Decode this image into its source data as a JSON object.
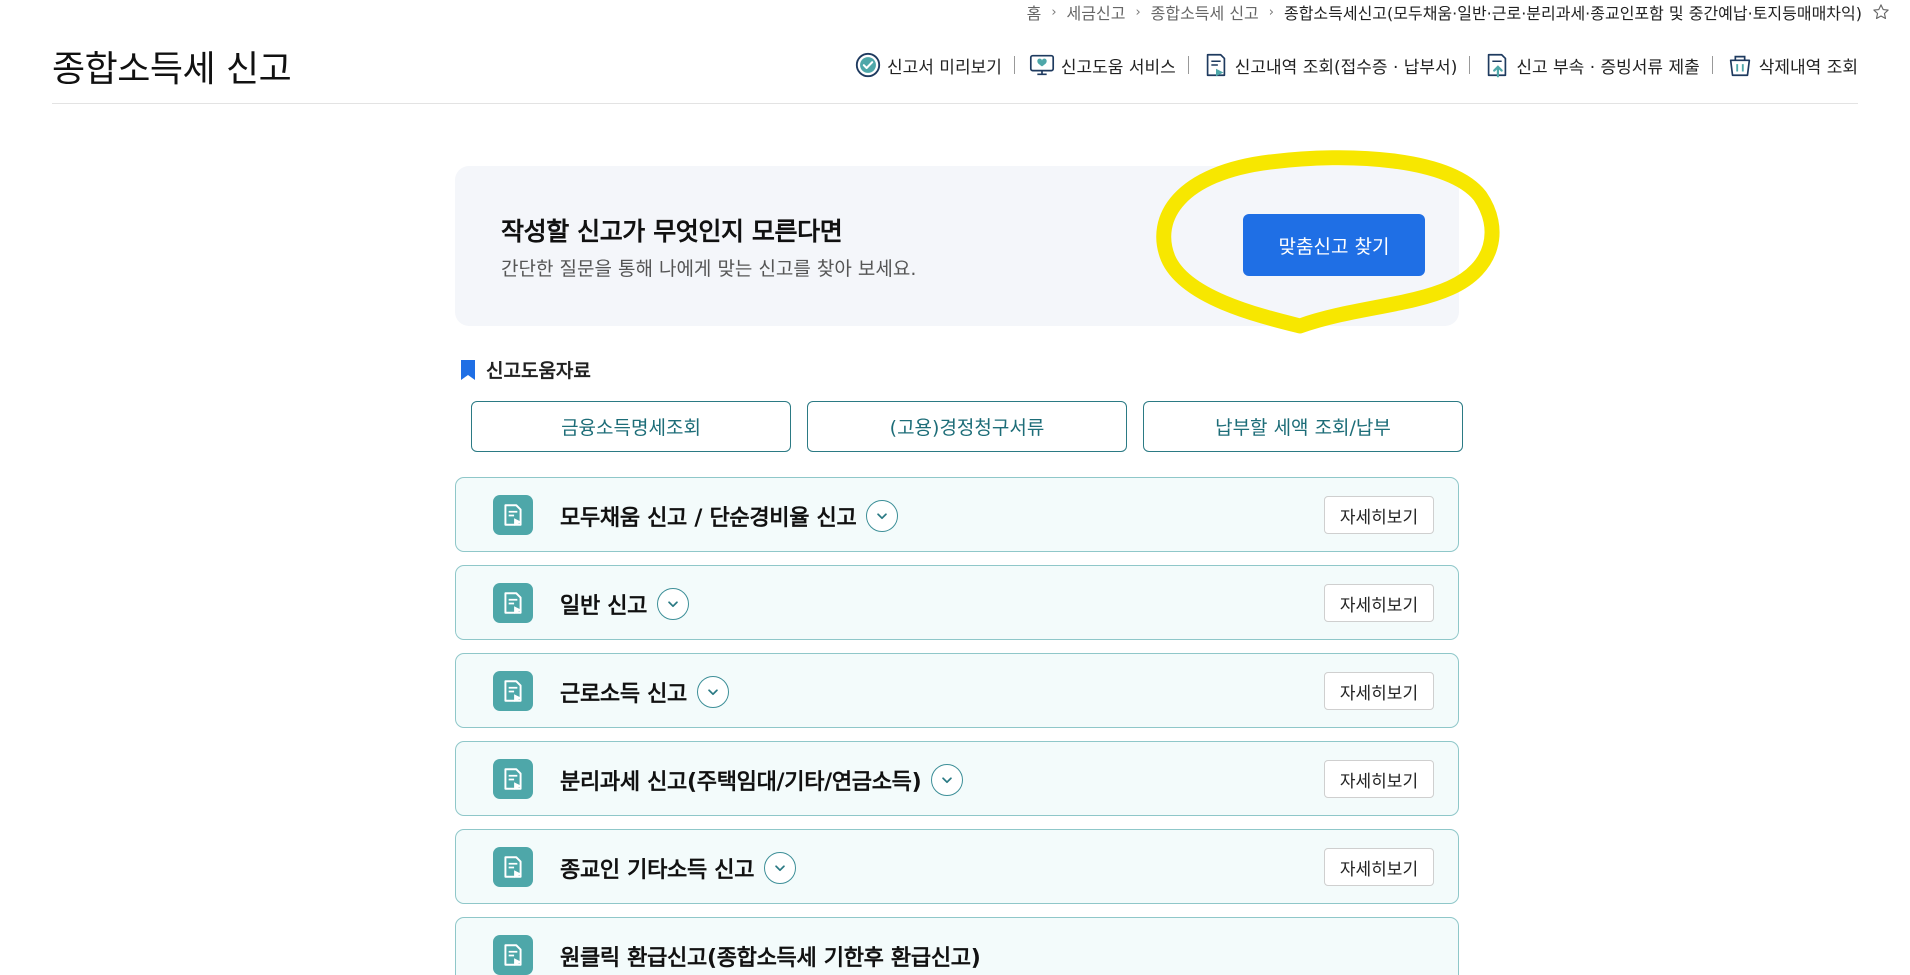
{
  "breadcrumb": {
    "items": [
      "홈",
      "세금신고",
      "종합소득세 신고",
      "종합소득세신고(모두채움·일반·근로·분리과세·종교인포함 및 중간예납·토지등매매차익)"
    ],
    "separator": "›"
  },
  "header": {
    "title": "종합소득세 신고",
    "quick_links": [
      {
        "label": "신고서 미리보기",
        "icon": "check-circle-icon"
      },
      {
        "label": "신고도움 서비스",
        "icon": "monitor-heart-icon"
      },
      {
        "label": "신고내역 조회(접수증 · 납부서)",
        "icon": "document-search-icon"
      },
      {
        "label": "신고 부속 · 증빙서류 제출",
        "icon": "document-upload-icon"
      },
      {
        "label": "삭제내역 조회",
        "icon": "trash-basket-icon"
      }
    ]
  },
  "intro": {
    "title": "작성할 신고가 무엇인지 모른다면",
    "subtitle": "간단한 질문을 통해 나에게 맞는 신고를 찾아 보세요.",
    "button_label": "맞춤신고 찾기"
  },
  "help": {
    "heading": "신고도움자료",
    "buttons": [
      "금융소득명세조회",
      "(고용)경정청구서류",
      "납부할 세액 조회/납부"
    ]
  },
  "reports": {
    "detail_label": "자세히보기",
    "items": [
      {
        "label": "모두채움 신고 / 단순경비율 신고",
        "has_toggle": true,
        "has_detail": true
      },
      {
        "label": "일반 신고",
        "has_toggle": true,
        "has_detail": true
      },
      {
        "label": "근로소득 신고",
        "has_toggle": true,
        "has_detail": true
      },
      {
        "label": "분리과세 신고(주택임대/기타/연금소득)",
        "has_toggle": true,
        "has_detail": true
      },
      {
        "label": "종교인 기타소득 신고",
        "has_toggle": true,
        "has_detail": true
      },
      {
        "label": "원클릭 환급신고(종합소득세 기한후 환급신고)",
        "has_toggle": false,
        "has_detail": false
      }
    ]
  },
  "colors": {
    "primary_button": "#1f6fe5",
    "teal_accent": "#4ea7a9",
    "highlight_annotation": "#f7e700",
    "bookmark": "#1f6fe5"
  }
}
